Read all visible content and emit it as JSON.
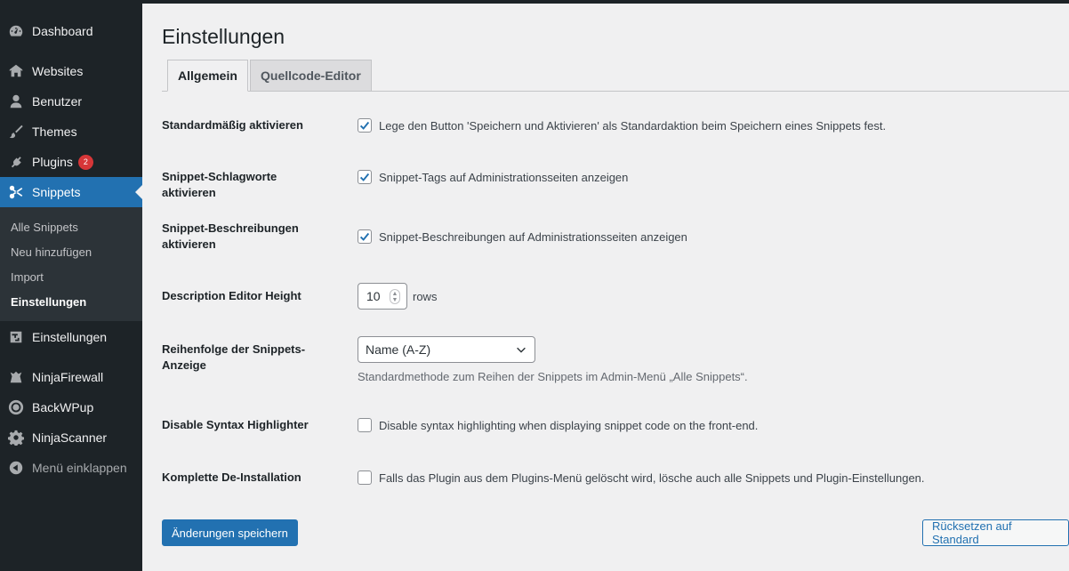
{
  "sidebar": {
    "items": [
      {
        "label": "Dashboard",
        "icon": "dashboard-icon"
      },
      {
        "label": "Websites",
        "icon": "websites-icon"
      },
      {
        "label": "Benutzer",
        "icon": "user-icon"
      },
      {
        "label": "Themes",
        "icon": "paintbrush-icon"
      },
      {
        "label": "Plugins",
        "icon": "plugin-icon",
        "badge": "2"
      },
      {
        "label": "Snippets",
        "icon": "scissors-icon"
      },
      {
        "label": "Einstellungen",
        "icon": "settings-icon"
      },
      {
        "label": "NinjaFirewall",
        "icon": "ninja-icon"
      },
      {
        "label": "BackWPup",
        "icon": "backup-icon"
      },
      {
        "label": "NinjaScanner",
        "icon": "gear-icon"
      },
      {
        "label": "Menü einklappen",
        "icon": "collapse-icon"
      }
    ],
    "submenu": [
      "Alle Snippets",
      "Neu hinzufügen",
      "Import",
      "Einstellungen"
    ]
  },
  "page": {
    "title": "Einstellungen",
    "tabs": [
      "Allgemein",
      "Quellcode-Editor"
    ]
  },
  "settings": {
    "activate_default": {
      "label": "Standardmäßig aktivieren",
      "text": "Lege den Button 'Speichern und Aktivieren' als Standardaktion beim Speichern eines Snippets fest.",
      "checked": true
    },
    "tags": {
      "label": "Snippet-Schlagworte aktivieren",
      "text": "Snippet-Tags auf Administrationsseiten anzeigen",
      "checked": true
    },
    "descriptions": {
      "label_line1": "Snippet-Beschreibungen",
      "label_line2": "aktivieren",
      "text": "Snippet-Beschreibungen auf Administrationsseiten anzeigen",
      "checked": true
    },
    "editor_height": {
      "label": "Description Editor Height",
      "value": "10",
      "unit": "rows"
    },
    "order": {
      "label_line1": "Reihenfolge der Snippets-",
      "label_line2": "Anzeige",
      "selected": "Name (A-Z)",
      "description": "Standardmethode zum Reihen der Snippets im Admin-Menü „Alle Snippets“."
    },
    "syntax": {
      "label": "Disable Syntax Highlighter",
      "text": "Disable syntax highlighting when displaying snippet code on the front-end.",
      "checked": false
    },
    "uninstall": {
      "label": "Komplette De-Installation",
      "text": "Falls das Plugin aus dem Plugins-Menü gelöscht wird, lösche auch alle Snippets und Plugin-Einstellungen.",
      "checked": false
    }
  },
  "buttons": {
    "save": "Änderungen speichern",
    "reset": "Rücksetzen auf Standard"
  },
  "colors": {
    "sidebar_bg": "#1d2327",
    "accent": "#2271b1",
    "badge": "#d63638"
  }
}
